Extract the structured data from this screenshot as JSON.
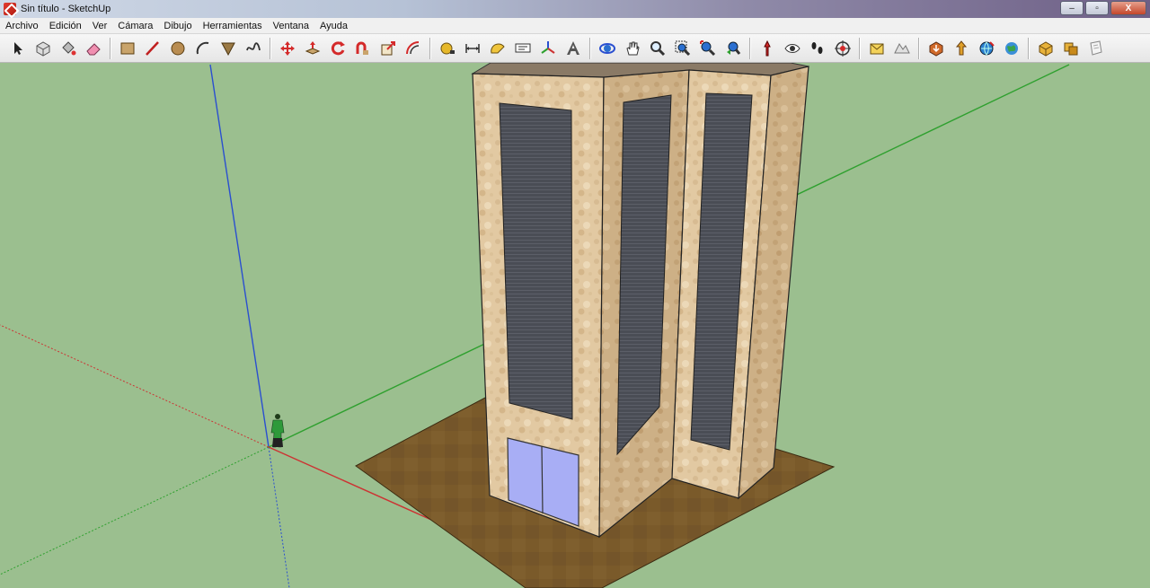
{
  "window": {
    "title": "Sin título - SketchUp",
    "controls": {
      "minimize": "–",
      "maximize": "▫",
      "close": "X"
    }
  },
  "menu": {
    "items": [
      "Archivo",
      "Edición",
      "Ver",
      "Cámara",
      "Dibujo",
      "Herramientas",
      "Ventana",
      "Ayuda"
    ]
  },
  "toolbar": {
    "tools": [
      "select-icon",
      "component-icon",
      "paint-bucket-icon",
      "eraser-icon",
      "rectangle-icon",
      "line-icon",
      "circle-icon",
      "arc-icon",
      "polygon-icon",
      "freehand-icon",
      "move-icon",
      "push-pull-icon",
      "rotate-icon",
      "follow-me-icon",
      "scale-icon",
      "offset-icon",
      "tape-measure-icon",
      "dimension-icon",
      "protractor-icon",
      "text-icon",
      "axes-icon",
      "3d-text-icon",
      "orbit-icon",
      "pan-icon",
      "zoom-icon",
      "zoom-window-icon",
      "zoom-extents-icon",
      "previous-view-icon",
      "position-camera-icon",
      "look-around-icon",
      "walk-icon",
      "section-plane-icon",
      "add-location-icon",
      "toggle-terrain-icon",
      "get-models-icon",
      "share-model-icon",
      "share-component-icon",
      "google-earth-icon",
      "extension-warehouse-icon",
      "extension-manager-icon",
      "layout-icon"
    ]
  },
  "scene": {
    "colors": {
      "ground": "#9bbf8f",
      "slab": "#7a5a2a",
      "wall_light": "#e2c9a2",
      "wall_dark": "#c9ab80",
      "window": "#4a4d55",
      "door": "#a8aef5",
      "axis_red": "#cc3333",
      "axis_green": "#2fa02f",
      "axis_blue": "#2a4fd0"
    }
  }
}
